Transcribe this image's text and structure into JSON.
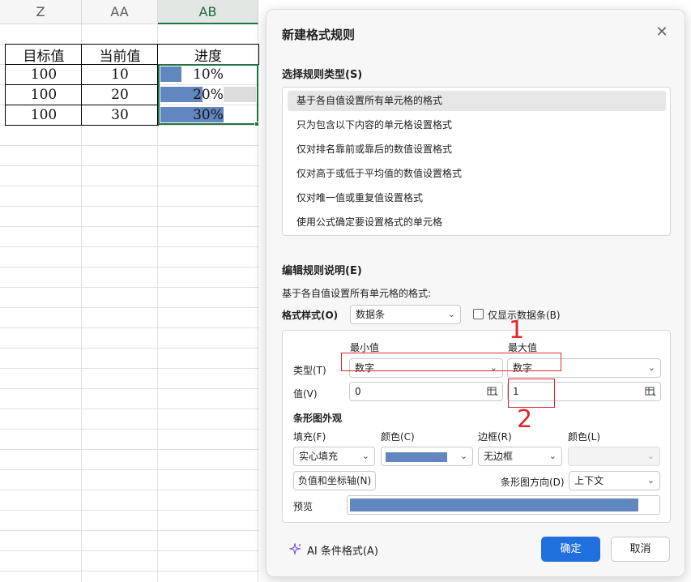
{
  "sheet": {
    "columns": [
      "Z",
      "AA",
      "AB"
    ],
    "active_column": "AB",
    "table": {
      "headers": [
        "目标值",
        "当前值",
        "进度"
      ],
      "rows": [
        {
          "target": "100",
          "current": "10",
          "progress": "10%",
          "progress_value": 0.1
        },
        {
          "target": "100",
          "current": "20",
          "progress": "20%",
          "progress_value": 0.2
        },
        {
          "target": "100",
          "current": "30",
          "progress": "30%",
          "progress_value": 0.3
        }
      ]
    },
    "databar_color": "#6286bf",
    "selection_color": "#217346"
  },
  "dialog": {
    "title": "新建格式规则",
    "close_icon": "close-icon",
    "rule_type_label": "选择规则类型(S)",
    "rule_types": [
      "基于各自值设置所有单元格的格式",
      "只为包含以下内容的单元格设置格式",
      "仅对排名靠前或靠后的数值设置格式",
      "仅对高于或低于平均值的数值设置格式",
      "仅对唯一值或重复值设置格式",
      "使用公式确定要设置格式的单元格"
    ],
    "selected_rule_index": 0,
    "edit_label": "编辑规则说明(E)",
    "edit_desc": "基于各自值设置所有单元格的格式:",
    "format_style_label": "格式样式(O)",
    "format_style_value": "数据条",
    "show_bar_only_label": "仅显示数据条(B)",
    "show_bar_only_checked": false,
    "min_label": "最小值",
    "max_label": "最大值",
    "type_label": "类型(T)",
    "min_type": "数字",
    "max_type": "数字",
    "value_label": "值(V)",
    "min_value": "0",
    "max_value": "1",
    "bar_appearance_label": "条形图外观",
    "fill_label": "填充(F)",
    "fill_value": "实心填充",
    "color_label": "颜色(C)",
    "bar_color": "#6286bf",
    "border_label": "边框(R)",
    "border_value": "无边框",
    "border_color_label": "颜色(L)",
    "negative_axis_button": "负值和坐标轴(N)",
    "bar_direction_label": "条形图方向(D)",
    "bar_direction_value": "上下文",
    "preview_label": "预览",
    "ai_button": "AI 条件格式(A)",
    "ok_button": "确定",
    "cancel_button": "取消",
    "accent_color": "#1f6fdc"
  },
  "annotations": {
    "marker_1": "1",
    "marker_2": "2",
    "color": "#e0262b"
  }
}
